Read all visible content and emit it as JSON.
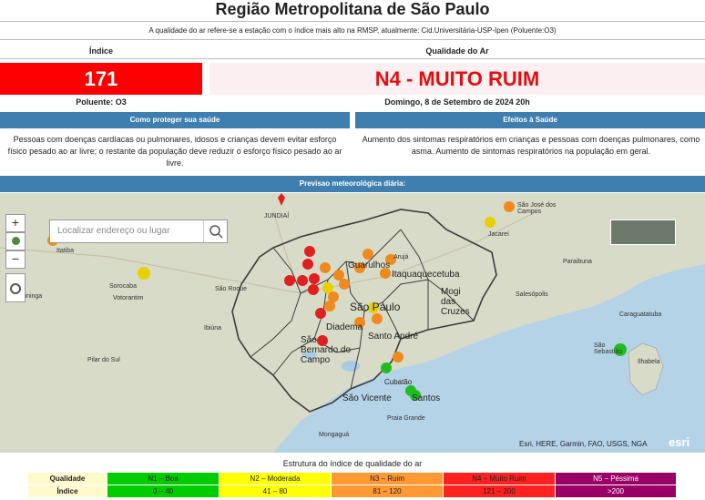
{
  "header": {
    "title": "Região Metropolitana de São Paulo",
    "subtitle": "A qualidade do ar refere-se a estação com o índice mais alto na RMSP, atualmente: Cid.Universitária-USP-Ipen (Poluente:O3)"
  },
  "summary": {
    "index_label": "Índice",
    "quality_label": "Qualidade do Ar",
    "index_value": "171",
    "quality_value": "N4 - MUITO RUIM",
    "pollutant": "Poluente: O3",
    "datetime": "Domingo, 8 de Setembro de 2024  20h",
    "colors": {
      "index_bg": "#ff0000",
      "quality_text": "#e01010",
      "bar": "#3f7fb0"
    }
  },
  "advice": {
    "protect_header": "Como proteger sua saúde",
    "effects_header": "Efeitos à Saúde",
    "protect_text": "Pessoas com doenças cardíacas ou pulmonares, idosos e crianças devem evitar esforço físico pesado ao ar livre; o restante da população deve reduzir o esforço físico pesado ao ar livre.",
    "effects_text": "Aumento dos sintomas respiratórios em crianças e pessoas com doenças pulmonares, como asma. Aumento de sintomas respiratórios na população em geral."
  },
  "forecast": {
    "header": "Previsao meteorológica diária:"
  },
  "map": {
    "search_placeholder": "Localizar endereço ou lugar",
    "zoom_in": "+",
    "zoom_out": "−",
    "attribution": "Esri, HERE, Garmin, FAO, USGS, NGA",
    "logo": "esri",
    "labels": {
      "jundiai": "JUNDIAÍ",
      "sao_jose": "São José dos Campos",
      "jacarei": "Jacareí",
      "sorocaba": "Sorocaba",
      "votorantim": "Votorantim",
      "itatiba": "Itatiba",
      "itapetininga": "Itapetininga",
      "sao_roque": "São Roque",
      "ibiuna": "Ibiúna",
      "pilar_do_sul": "Pilar do Sul",
      "aruja": "Arujá",
      "guarulhos": "Guarulhos",
      "itaquaquecetuba": "Itaquaquecetuba",
      "mogi": "Mogi das Cruzes",
      "sao_paulo": "São Paulo",
      "diadema": "Diadema",
      "santo_andre": "Santo André",
      "sao_bernardo": "São Bernardo do Campo",
      "sao_vicente": "São Vicente",
      "santos": "Santos",
      "cubatao": "Cubatão",
      "praia_grande": "Praia Grande",
      "mongagua": "Mongaguá",
      "caraguatatuba": "Caraguatatuba",
      "sao_sebastiao": "São Sebastião",
      "ilhabela": "Ilhabela",
      "salesopolis": "Salesópolis",
      "paraibuna": "Paraibuna"
    }
  },
  "legend": {
    "title": "Estrutura do índice de qualidade do ar",
    "row1_label": "Qualidade",
    "row2_label": "Índice",
    "levels": [
      {
        "name": "N1 – Boa",
        "range": "0 – 40",
        "color": "#00cc00"
      },
      {
        "name": "N2 – Moderada",
        "range": "41 – 80",
        "color": "#ffff00"
      },
      {
        "name": "N3 – Ruim",
        "range": "81 – 120",
        "color": "#ff9933"
      },
      {
        "name": "N4 – Muito Ruim",
        "range": "121 – 200",
        "color": "#ff2020"
      },
      {
        "name": "N5 – Péssima",
        "range": ">200",
        "color": "#990066"
      }
    ]
  }
}
